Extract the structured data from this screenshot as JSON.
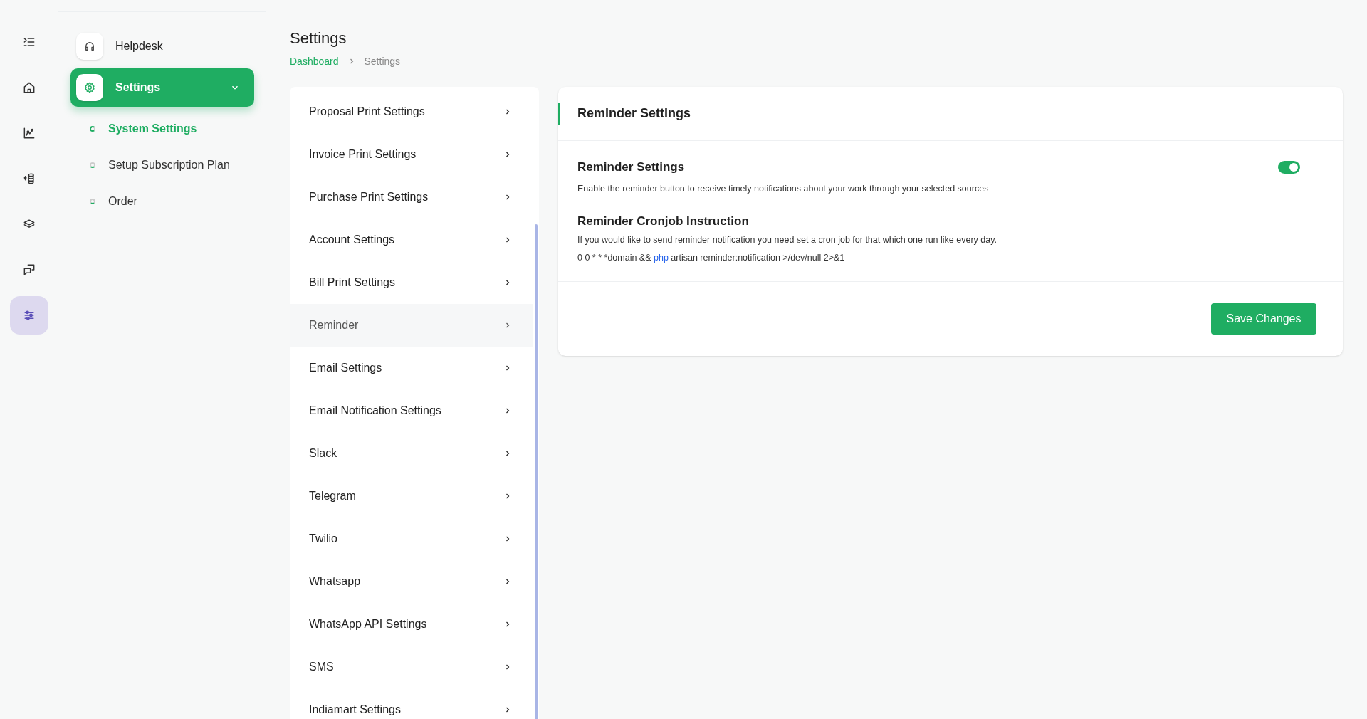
{
  "rail": [
    {
      "selected": false
    },
    {
      "selected": false
    },
    {
      "selected": false
    },
    {
      "selected": false
    },
    {
      "selected": false
    },
    {
      "selected": false
    },
    {
      "selected": true
    }
  ],
  "sidebar": {
    "items": [
      {
        "label": "Helpdesk",
        "selected": false
      },
      {
        "label": "Settings",
        "selected": true,
        "expanded": true,
        "children": [
          {
            "label": "System Settings",
            "selected": true
          },
          {
            "label": "Setup Subscription Plan",
            "selected": false
          },
          {
            "label": "Order",
            "selected": false
          }
        ]
      }
    ]
  },
  "page": {
    "title": "Settings",
    "breadcrumb": [
      {
        "label": "Dashboard",
        "kind": "link"
      },
      {
        "label": "Settings",
        "kind": "current"
      }
    ]
  },
  "settings_menu": [
    {
      "label": "Proposal Print Settings",
      "selected": false
    },
    {
      "label": "Invoice Print Settings",
      "selected": false
    },
    {
      "label": "Purchase Print Settings",
      "selected": false
    },
    {
      "label": "Account Settings",
      "selected": false
    },
    {
      "label": "Bill Print Settings",
      "selected": false
    },
    {
      "label": "Reminder",
      "selected": true
    },
    {
      "label": "Email Settings",
      "selected": false
    },
    {
      "label": "Email Notification Settings",
      "selected": false
    },
    {
      "label": "Slack",
      "selected": false
    },
    {
      "label": "Telegram",
      "selected": false
    },
    {
      "label": "Twilio",
      "selected": false
    },
    {
      "label": "Whatsapp",
      "selected": false
    },
    {
      "label": "WhatsApp API Settings",
      "selected": false
    },
    {
      "label": "SMS",
      "selected": false
    },
    {
      "label": "Indiamart Settings",
      "selected": false
    }
  ],
  "card": {
    "title": "Reminder Settings",
    "setting": {
      "label": "Reminder Settings",
      "description": "Enable the reminder button to receive timely notifications about your work through your selected sources",
      "on": true
    },
    "instruction": {
      "title": "Reminder Cronjob Instruction",
      "text": "If you would like to send reminder notification you need set a cron job for that which one run like every day.",
      "command": [
        {
          "text": "0 0 * * *domain && ",
          "highlighted": false
        },
        {
          "text": "php",
          "highlighted": true
        },
        {
          "text": " artisan reminder:notification >/dev/null 2>&1",
          "highlighted": false
        }
      ]
    },
    "button": "Save Changes"
  }
}
